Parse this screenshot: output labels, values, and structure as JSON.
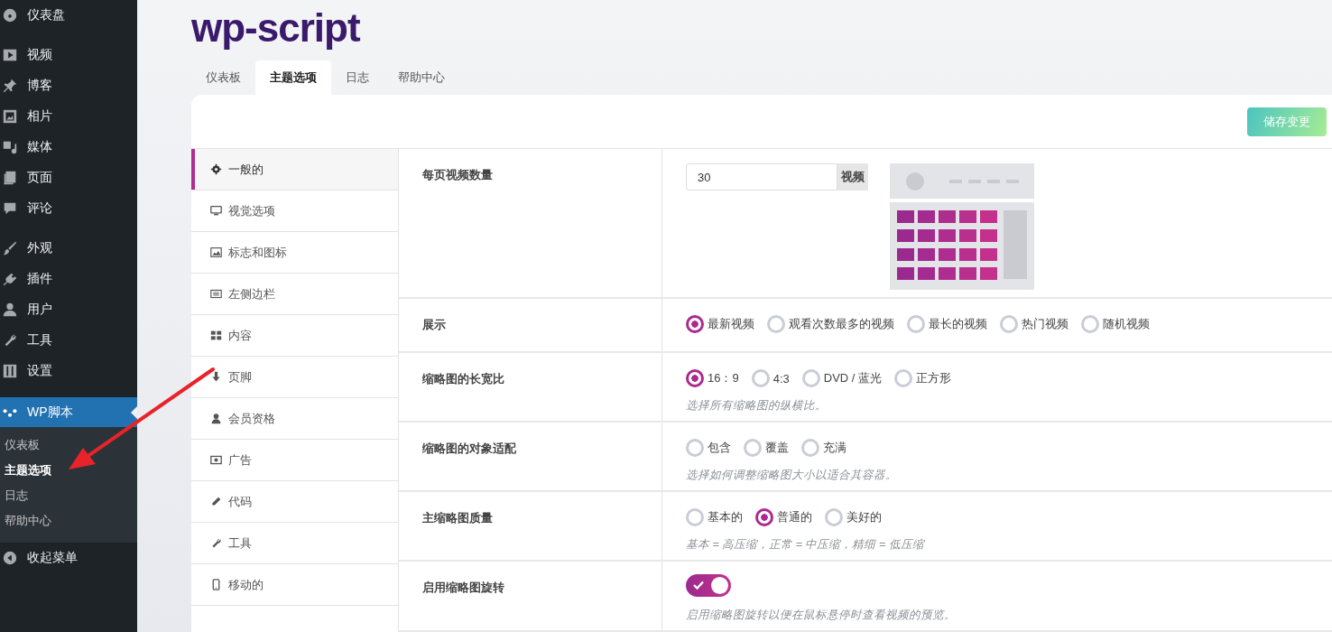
{
  "admin_menu": {
    "groups": [
      [
        {
          "label": "仪表盘",
          "selected": false
        }
      ],
      [
        {
          "label": "视频",
          "selected": false
        },
        {
          "label": "博客",
          "selected": false
        },
        {
          "label": "相片",
          "selected": false
        },
        {
          "label": "媒体",
          "selected": false
        },
        {
          "label": "页面",
          "selected": false
        },
        {
          "label": "评论",
          "selected": false
        }
      ],
      [
        {
          "label": "外观",
          "selected": false
        },
        {
          "label": "插件",
          "selected": false
        },
        {
          "label": "用户",
          "selected": false
        },
        {
          "label": "工具",
          "selected": false
        },
        {
          "label": "设置",
          "selected": false
        }
      ]
    ],
    "active_menu": {
      "label": "WP脚本",
      "submenu": [
        {
          "label": "仪表板",
          "selected": false
        },
        {
          "label": "主题选项",
          "selected": true
        },
        {
          "label": "日志",
          "selected": false
        },
        {
          "label": "帮助中心",
          "selected": false
        }
      ]
    },
    "collapse": "收起菜单"
  },
  "plugin": {
    "logo": "wp-script",
    "tabs": [
      {
        "label": "仪表板",
        "selected": false
      },
      {
        "label": "主题选项",
        "selected": true
      },
      {
        "label": "日志",
        "selected": false
      },
      {
        "label": "帮助中心",
        "selected": false
      }
    ],
    "save_button": "储存变更",
    "sections": [
      {
        "label": "一般的",
        "selected": true
      },
      {
        "label": "视觉选项",
        "selected": false
      },
      {
        "label": "标志和图标",
        "selected": false
      },
      {
        "label": "左侧边栏",
        "selected": false
      },
      {
        "label": "内容",
        "selected": false
      },
      {
        "label": "页脚",
        "selected": false
      },
      {
        "label": "会员资格",
        "selected": false
      },
      {
        "label": "广告",
        "selected": false
      },
      {
        "label": "代码",
        "selected": false
      },
      {
        "label": "工具",
        "selected": false
      },
      {
        "label": "移动的",
        "selected": false
      }
    ],
    "settings": [
      {
        "kind": "number",
        "label": "每页视频数量",
        "value": "30",
        "unit": "视频"
      },
      {
        "kind": "radio",
        "label": "展示",
        "options": [
          {
            "label": "最新视频",
            "selected": true
          },
          {
            "label": "观看次数最多的视频",
            "selected": false
          },
          {
            "label": "最长的视频",
            "selected": false
          },
          {
            "label": "热门视频",
            "selected": false
          },
          {
            "label": "随机视频",
            "selected": false
          }
        ]
      },
      {
        "kind": "radio",
        "label": "缩略图的长宽比",
        "options": [
          {
            "label": "16：9",
            "selected": true
          },
          {
            "label": "4:3",
            "selected": false
          },
          {
            "label": "DVD / 蓝光",
            "selected": false
          },
          {
            "label": "正方形",
            "selected": false
          }
        ],
        "hint": "选择所有缩略图的纵横比。"
      },
      {
        "kind": "radio",
        "label": "缩略图的对象适配",
        "options": [
          {
            "label": "包含",
            "selected": false
          },
          {
            "label": "覆盖",
            "selected": false
          },
          {
            "label": "充满",
            "selected": false
          }
        ],
        "hint": "选择如何调整缩略图大小以适合其容器。"
      },
      {
        "kind": "radio",
        "label": "主缩略图质量",
        "options": [
          {
            "label": "基本的",
            "selected": false
          },
          {
            "label": "普通的",
            "selected": true
          },
          {
            "label": "美好的",
            "selected": false
          }
        ],
        "hint": "基本 = 高压缩，正常 = 中压缩，精细 = 低压缩"
      },
      {
        "kind": "toggle",
        "label": "启用缩略图旋转",
        "on": true,
        "hint": "启用缩略图旋转以便在鼠标悬停时查看视频的预览。"
      }
    ]
  }
}
